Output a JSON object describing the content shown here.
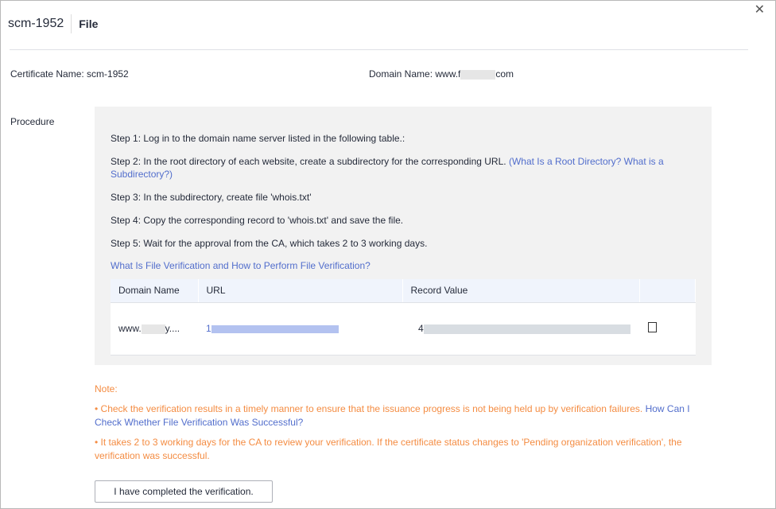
{
  "header": {
    "title": "scm-1952",
    "subtitle": "File",
    "close": "✕"
  },
  "info": {
    "cert_label": "Certificate Name: scm-1952",
    "domain_prefix": "Domain Name: www.f",
    "domain_suffix": "com"
  },
  "procedure": {
    "label": "Procedure",
    "steps": [
      "Step 1: Log in to the domain name server listed in the following table.:",
      "Step 2: In the root directory of each website, create a subdirectory for the corresponding URL.",
      "Step 3: In the subdirectory, create file 'whois.txt'",
      "Step 4: Copy the corresponding record to 'whois.txt' and save the file.",
      "Step 5: Wait for the approval from the CA, which takes 2 to 3 working days."
    ],
    "step2_link": "(What Is a Root Directory?  What is a Subdirectory?)",
    "help_link": "What Is File Verification and How to Perform File Verification?",
    "table": {
      "headers": [
        "Domain Name",
        "URL",
        "Record Value"
      ],
      "row": {
        "domain_prefix": "www.",
        "domain_suffix": "y....",
        "url_prefix": "1",
        "record_prefix": "4"
      }
    }
  },
  "notes": {
    "title": "Note:",
    "n1": "• Check the verification results in a timely manner to ensure that the issuance progress is not being held up by verification failures.",
    "n1_link": "How Can I Check Whether File Verification Was Successful?",
    "n2": "• It takes 2 to 3 working days for the CA to review your verification. If the certificate status changes to 'Pending organization verification', the verification was successful."
  },
  "button": "I have completed the verification."
}
